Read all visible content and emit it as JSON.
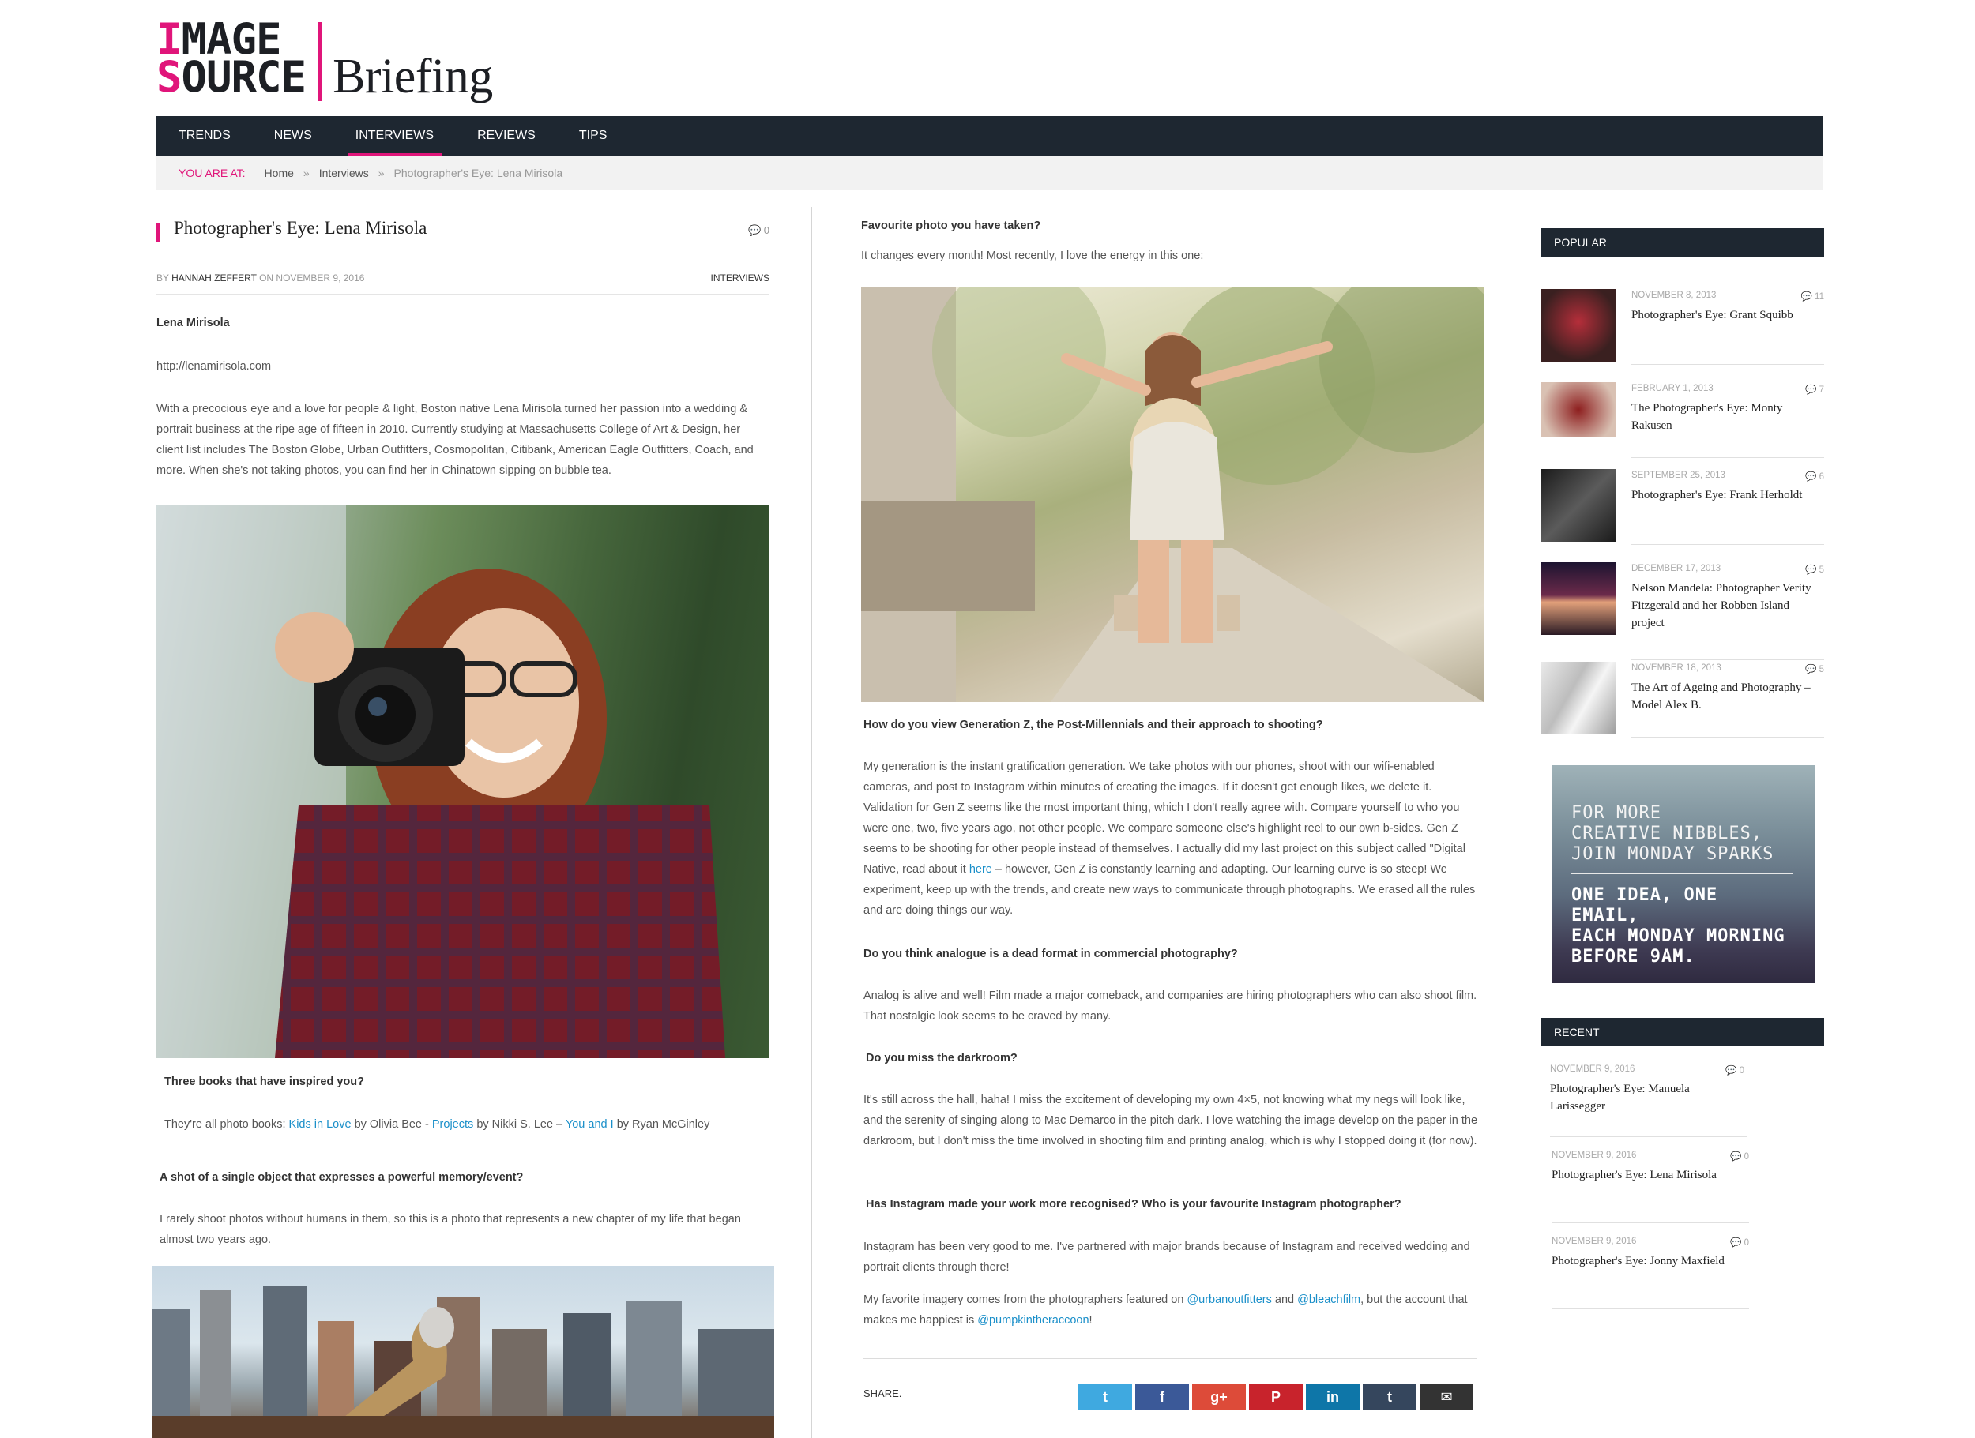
{
  "logo": {
    "line1_accent": "I",
    "line1_rest": "MAGE",
    "line2_accent": "S",
    "line2_rest": "OURCE",
    "brand": "Briefing"
  },
  "nav": [
    "TRENDS",
    "NEWS",
    "INTERVIEWS",
    "REVIEWS",
    "TIPS"
  ],
  "breadcrumb": {
    "label": "YOU ARE AT:",
    "home": "Home",
    "section": "Interviews",
    "current": "Photographer's Eye: Lena Mirisola",
    "sep": "»"
  },
  "post": {
    "title": "Photographer's Eye: Lena Mirisola",
    "comments": "0",
    "by": "BY",
    "author": "HANNAH ZEFFERT",
    "on_date": "ON NOVEMBER 9, 2016",
    "category": "INTERVIEWS",
    "name": "Lena Mirisola",
    "url": "http://lenamirisola.com",
    "intro": "With a precocious eye and a love for people & light, Boston native Lena Mirisola turned her passion into a wedding & portrait business at the ripe age of fifteen in 2010. Currently studying at Massachusetts College of Art & Design, her client list includes The Boston Globe, Urban Outfitters, Cosmopolitan, Citibank, American Eagle Outfitters, Coach, and more. When she's not taking photos, you can find her in Chinatown sipping on bubble tea.",
    "q1": "Three books that have inspired you?",
    "a1_prefix": "They're all photo books:",
    "a1_b1": "Kids in Love",
    "a1_by1": "by Olivia Bee -",
    "a1_b2": "Projects",
    "a1_by2": "by Nikki S. Lee –",
    "a1_b3": "You and I",
    "a1_by3": "by Ryan McGinley",
    "q2": "A shot of a single object that expresses a powerful memory/event?",
    "a2": "I rarely shoot photos without humans in them, so this is a photo that represents a new chapter of my life that began almost two years ago.",
    "q3": "Favourite photo you have taken?",
    "a3": "It changes every month! Most recently, I love the energy in this one:",
    "q4": "How do you view Generation Z, the Post-Millennials and their approach to shooting?",
    "a4_part1": "My generation is the instant gratification generation. We take photos with our phones, shoot with our wifi-enabled cameras, and post to Instagram within minutes of creating the images. If it doesn't get enough likes, we delete it. Validation for Gen Z seems like the most important thing, which I don't really agree with. Compare yourself to who you were one, two, five years ago, not other people. We compare someone else's highlight reel to our own b-sides. Gen Z seems to be shooting for other people instead of themselves. I actually did my last project on this subject called \"Digital Native, read about it",
    "a4_link": "here",
    "a4_part2": "– however, Gen Z is constantly learning and adapting. Our learning curve is so steep! We experiment, keep up with the trends, and create new ways to communicate through photographs. We erased all the rules and are doing things our way.",
    "q5": "Do you think analogue is a dead format in commercial photography?",
    "a5": "Analog is alive and well! Film made a major comeback, and companies are hiring photographers who can also shoot film. That nostalgic look seems to be craved by many.",
    "q6": "Do you miss the darkroom?",
    "a6": "It's still across the hall, haha! I miss the excitement of developing my own 4×5, not knowing what my negs will look like, and the serenity of singing along to Mac Demarco in the pitch dark. I love watching the image develop on the paper in the darkroom, but I don't miss the time involved in shooting film and printing analog, which is why I stopped doing it (for now).",
    "q7": "Has Instagram made your work more recognised? Who is your favourite Instagram photographer?",
    "a7": "Instagram has been very good to me. I've partnered with major brands because of Instagram and received wedding and portrait clients through there!",
    "a8_prefix": "My favorite imagery comes from the photographers featured on",
    "a8_l1": "@urbanoutfitters",
    "a8_and": "and",
    "a8_l2": "@bleachfilm",
    "a8_mid": ", but the account that makes me happiest is",
    "a8_l3": "@pumpkintheraccoon",
    "a8_end": "!"
  },
  "share": {
    "label": "SHARE.",
    "buttons": [
      {
        "icon": "twitter-icon",
        "glyph": "t",
        "color": "#3fa9e0"
      },
      {
        "icon": "facebook-icon",
        "glyph": "f",
        "color": "#3b5998"
      },
      {
        "icon": "google-plus-icon",
        "glyph": "g+",
        "color": "#dd4b39"
      },
      {
        "icon": "pinterest-icon",
        "glyph": "P",
        "color": "#c8232c"
      },
      {
        "icon": "linkedin-icon",
        "glyph": "in",
        "color": "#0e76a8"
      },
      {
        "icon": "tumblr-icon",
        "glyph": "t",
        "color": "#35465d"
      },
      {
        "icon": "email-icon",
        "glyph": "✉",
        "color": "#333333"
      }
    ]
  },
  "sidebar": {
    "popular_title": "POPULAR",
    "popular": [
      {
        "date": "NOVEMBER 8, 2013",
        "count": "11",
        "title": "Photographer's Eye: Grant Squibb"
      },
      {
        "date": "FEBRUARY 1, 2013",
        "count": "7",
        "title": "The Photographer's Eye: Monty Rakusen"
      },
      {
        "date": "SEPTEMBER 25, 2013",
        "count": "6",
        "title": "Photographer's Eye: Frank Herholdt"
      },
      {
        "date": "DECEMBER 17, 2013",
        "count": "5",
        "title": "Nelson Mandela: Photographer Verity Fitzgerald and her Robben Island project"
      },
      {
        "date": "NOVEMBER 18, 2013",
        "count": "5",
        "title": "The Art of Ageing and Photography – Model Alex B."
      }
    ],
    "promo": {
      "l1": "FOR MORE",
      "l2": "CREATIVE NIBBLES,",
      "l3": "JOIN MONDAY SPARKS",
      "l4": "ONE IDEA, ONE EMAIL,",
      "l5": "EACH MONDAY MORNING",
      "l6": "BEFORE 9AM."
    },
    "recent_title": "RECENT",
    "recent": [
      {
        "date": "NOVEMBER 9, 2016",
        "count": "0",
        "title": "Photographer's Eye: Manuela Larissegger"
      },
      {
        "date": "NOVEMBER 9, 2016",
        "count": "0",
        "title": "Photographer's Eye: Lena Mirisola"
      },
      {
        "date": "NOVEMBER 9, 2016",
        "count": "0",
        "title": "Photographer's Eye: Jonny Maxfield"
      }
    ]
  }
}
